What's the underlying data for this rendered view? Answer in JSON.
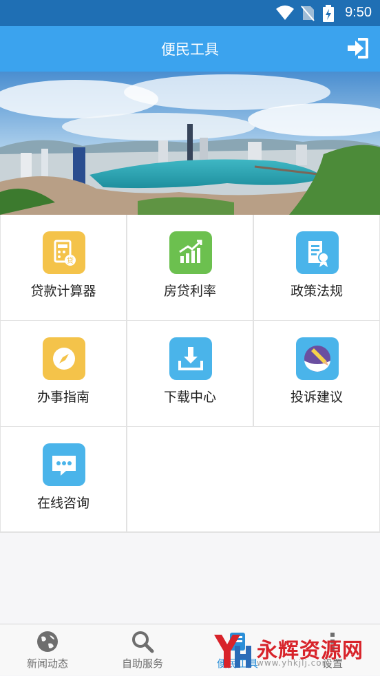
{
  "status_bar": {
    "time": "9:50"
  },
  "app_bar": {
    "title": "便民工具",
    "login_icon": "login-icon"
  },
  "tools": [
    {
      "label": "贷款计算器",
      "icon": "calculator-icon",
      "color": "#f4c34a"
    },
    {
      "label": "房贷利率",
      "icon": "chart-up-icon",
      "color": "#6cc04f"
    },
    {
      "label": "政策法规",
      "icon": "certificate-icon",
      "color": "#4ab4ea"
    },
    {
      "label": "办事指南",
      "icon": "compass-icon",
      "color": "#f4c34a"
    },
    {
      "label": "下载中心",
      "icon": "download-icon",
      "color": "#4ab4ea"
    },
    {
      "label": "投诉建议",
      "icon": "pencil-note-icon",
      "color": "#4ab4ea"
    },
    {
      "label": "在线咨询",
      "icon": "chat-icon",
      "color": "#4ab4ea"
    }
  ],
  "tab_bar": {
    "tabs": [
      {
        "label": "新闻动态",
        "icon": "globe-icon",
        "active": false
      },
      {
        "label": "自助服务",
        "icon": "search-icon",
        "active": false
      },
      {
        "label": "便民工具",
        "icon": "tools-icon",
        "active": true
      },
      {
        "label": "设置",
        "icon": "more-icon",
        "active": false
      }
    ]
  },
  "watermark": {
    "text": "永辉资源网",
    "url": "www.yhkjlj.com"
  },
  "colors": {
    "status_bar": "#1f6fb4",
    "app_bar": "#3ba3ee",
    "accent": "#2b8fd8"
  }
}
